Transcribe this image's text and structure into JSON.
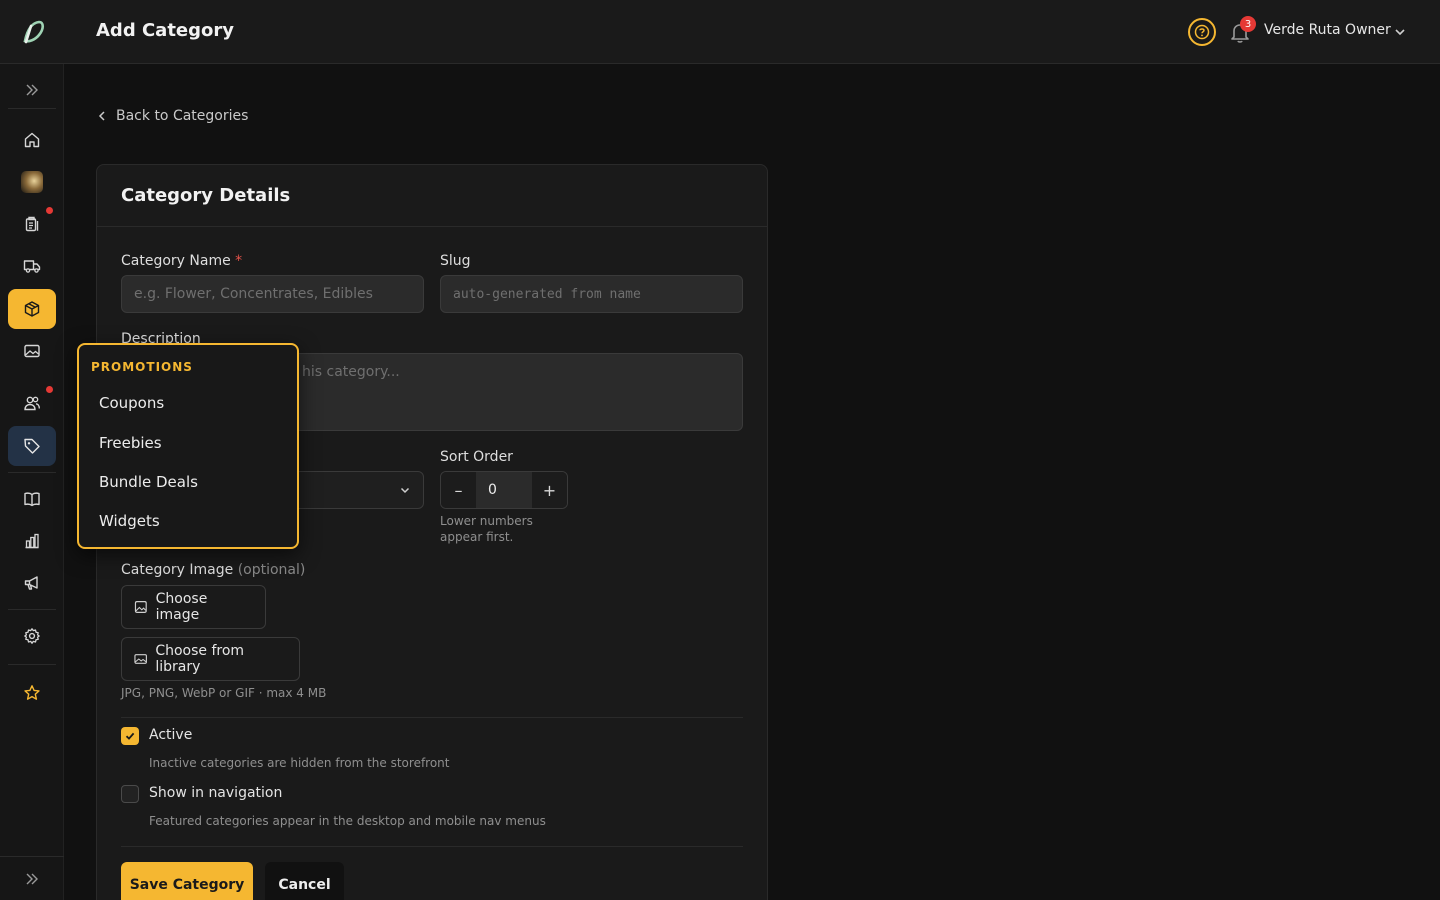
{
  "header": {
    "title": "Add Category",
    "notification_count": "3",
    "user_name": "Verde Ruta Owner"
  },
  "colors": {
    "accent": "#f5b731",
    "alert": "#e53935",
    "hover": "#233246"
  },
  "sidebar": {
    "items": [
      {
        "name": "home",
        "icon": "home-icon"
      },
      {
        "name": "store",
        "icon": "store-avatar-icon"
      },
      {
        "name": "orders",
        "icon": "clipboard-icon",
        "dot": true
      },
      {
        "name": "delivery",
        "icon": "truck-icon"
      },
      {
        "name": "products",
        "icon": "box-icon",
        "active": true
      },
      {
        "name": "media",
        "icon": "image-icon"
      },
      {
        "name": "customers",
        "icon": "users-icon",
        "dot": true
      },
      {
        "name": "promotions",
        "icon": "tag-icon",
        "hover": true
      },
      {
        "name": "catalog",
        "icon": "book-icon"
      },
      {
        "name": "analytics",
        "icon": "bar-chart-icon"
      },
      {
        "name": "marketing",
        "icon": "megaphone-icon"
      },
      {
        "name": "settings",
        "icon": "gear-icon"
      },
      {
        "name": "favorites",
        "icon": "star-icon"
      }
    ]
  },
  "back_link": "Back to Categories",
  "card": {
    "title": "Category Details",
    "name_label": "Category Name",
    "required_mark": "*",
    "name_placeholder": "e.g. Flower, Concentrates, Edibles",
    "slug_label": "Slug",
    "slug_placeholder": "auto-generated from name",
    "description_label": "Description",
    "description_placeholder": "his category...",
    "sort_label": "Sort Order",
    "sort_value": "0",
    "sort_minus": "–",
    "sort_plus": "+",
    "sort_hint": "Lower numbers appear first.",
    "image_label": "Category Image",
    "image_optional": "(optional)",
    "choose_image": "Choose image",
    "choose_library": "Choose from library",
    "image_hint": "JPG, PNG, WebP or GIF · max 4 MB",
    "active_label": "Active",
    "active_checked": true,
    "active_hint": "Inactive categories are hidden from the storefront",
    "nav_label": "Show in navigation",
    "nav_checked": false,
    "nav_hint": "Featured categories appear in the desktop and mobile nav menus",
    "save": "Save Category",
    "cancel": "Cancel"
  },
  "flyout": {
    "heading": "PROMOTIONS",
    "items": [
      "Coupons",
      "Freebies",
      "Bundle Deals",
      "Widgets"
    ]
  }
}
